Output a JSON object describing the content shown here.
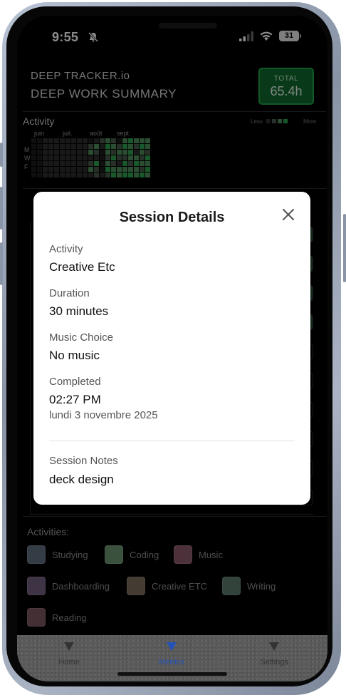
{
  "status_bar": {
    "time": "9:55",
    "battery": "31"
  },
  "header": {
    "brand": "DEEP TRACKER.io",
    "title": "DEEP WORK SUMMARY",
    "total_label": "TOTAL",
    "total_value": "65.4h"
  },
  "heatmap": {
    "heading": "Activity",
    "legend_less": "Less",
    "legend_more": "More",
    "months": [
      "juin",
      "juil.",
      "août",
      "sept."
    ],
    "days": [
      "M",
      "W",
      "F"
    ],
    "colors": [
      "#1d1d1d",
      "#2e2e2e",
      "#4a5a4c",
      "#4f8f5c",
      "#2fa14d"
    ],
    "grid": [
      [
        0,
        0,
        1,
        1,
        1,
        1,
        1,
        1,
        1,
        1,
        0,
        1,
        2,
        3,
        2,
        0,
        3,
        4,
        3,
        3,
        3
      ],
      [
        0,
        0,
        1,
        1,
        1,
        1,
        1,
        1,
        1,
        1,
        2,
        3,
        1,
        4,
        3,
        2,
        4,
        3,
        2,
        4,
        3
      ],
      [
        0,
        0,
        1,
        1,
        1,
        1,
        1,
        1,
        1,
        1,
        3,
        2,
        0,
        3,
        2,
        3,
        3,
        4,
        1,
        3,
        2
      ],
      [
        0,
        0,
        1,
        1,
        1,
        1,
        1,
        1,
        1,
        1,
        1,
        1,
        0,
        2,
        4,
        2,
        2,
        3,
        3,
        2,
        4
      ],
      [
        0,
        0,
        1,
        1,
        1,
        1,
        1,
        1,
        1,
        1,
        2,
        4,
        0,
        3,
        2,
        1,
        4,
        2,
        4,
        3,
        3
      ],
      [
        0,
        0,
        1,
        1,
        1,
        1,
        1,
        1,
        1,
        1,
        3,
        2,
        0,
        4,
        3,
        3,
        3,
        3,
        3,
        2,
        4
      ],
      [
        0,
        0,
        1,
        1,
        1,
        1,
        1,
        1,
        1,
        1,
        1,
        2,
        1,
        2,
        4,
        3,
        4,
        4,
        3,
        4,
        3
      ]
    ]
  },
  "activities": {
    "heading": "Activities:",
    "items": [
      {
        "label": "Studying",
        "color": "#5f6d7e"
      },
      {
        "label": "Coding",
        "color": "#6a9470"
      },
      {
        "label": "Music",
        "color": "#8a5a6a"
      },
      {
        "label": "Dashboarding",
        "color": "#74607f"
      },
      {
        "label": "Creative ETC",
        "color": "#7c6e5e"
      },
      {
        "label": "Writing",
        "color": "#5c7a6c"
      },
      {
        "label": "Reading",
        "color": "#7a5660"
      }
    ]
  },
  "tabs": [
    {
      "label": "Home"
    },
    {
      "label": "Metrics"
    },
    {
      "label": "Settings"
    }
  ],
  "modal": {
    "title": "Session Details",
    "activity_label": "Activity",
    "activity_value": "Creative Etc",
    "duration_label": "Duration",
    "duration_value": "30 minutes",
    "music_label": "Music Choice",
    "music_value": "No music",
    "completed_label": "Completed",
    "completed_time": "02:27 PM",
    "completed_date": "lundi 3 novembre 2025",
    "notes_label": "Session Notes",
    "notes_value": "deck design"
  }
}
